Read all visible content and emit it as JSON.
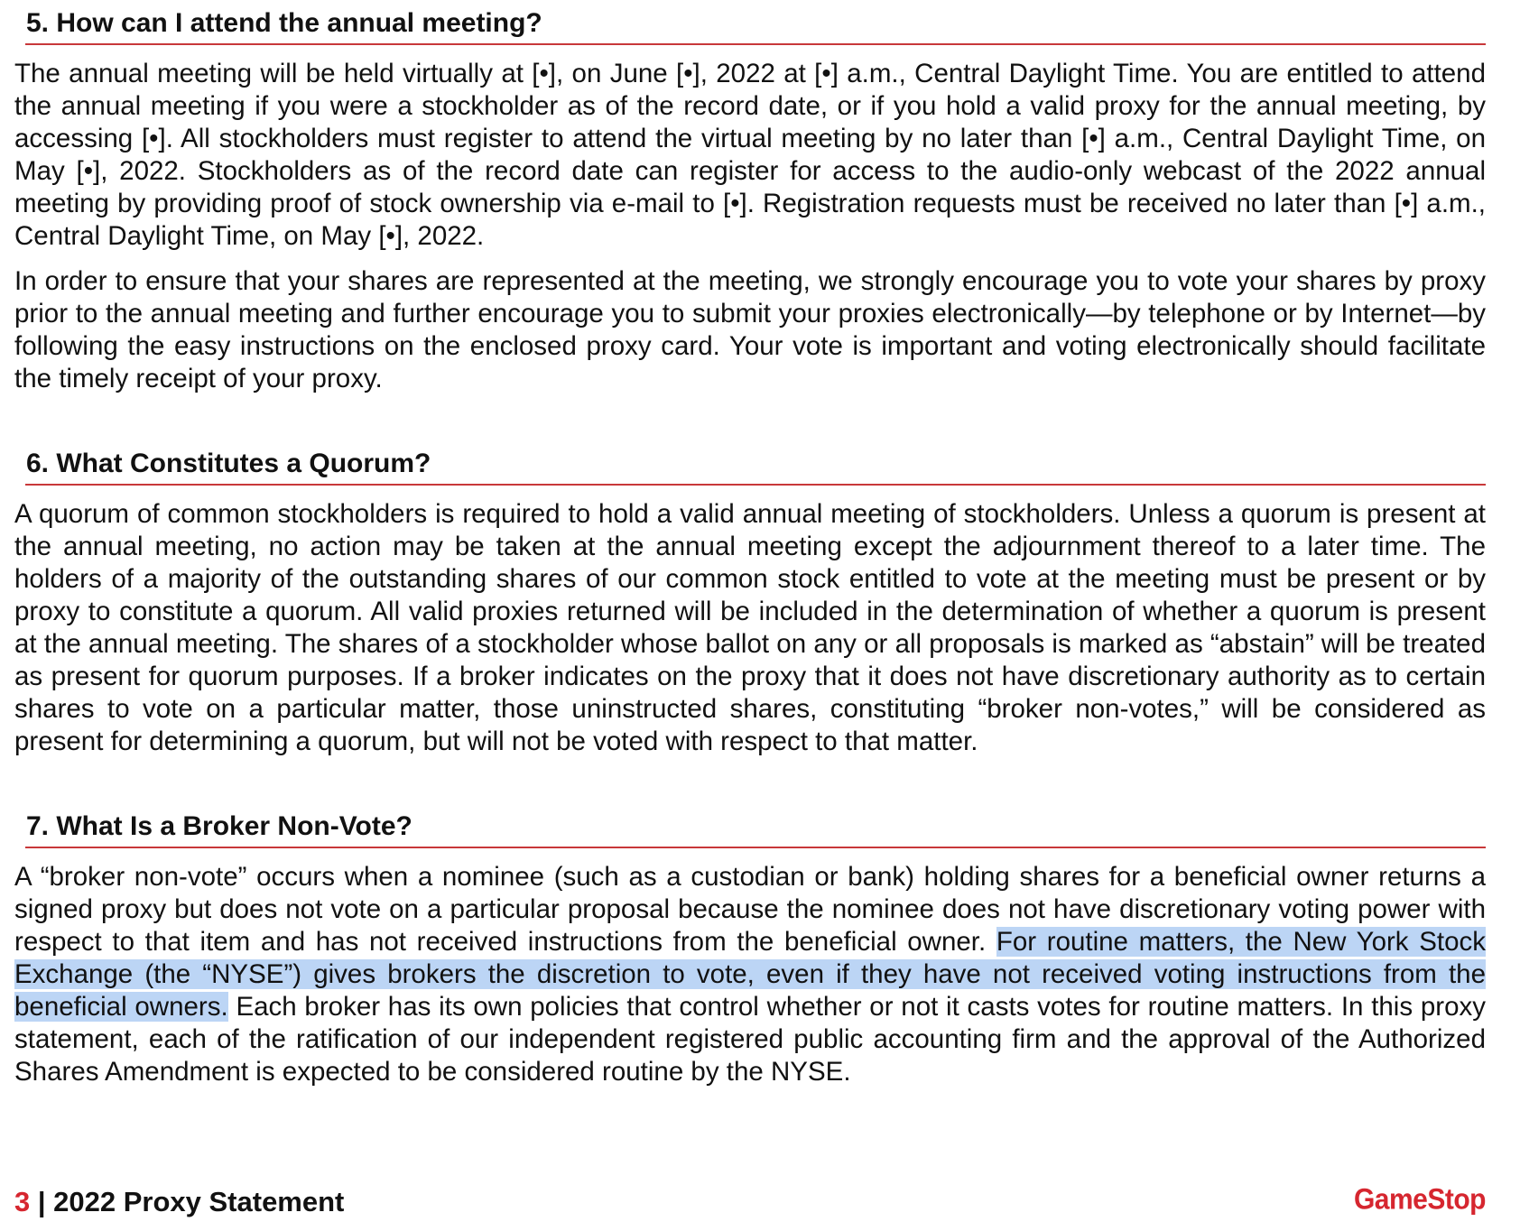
{
  "sections": [
    {
      "heading": "5. How can I attend the annual meeting?",
      "paragraphs": [
        "The annual meeting will be held virtually at [•], on June [•], 2022 at [•] a.m., Central Daylight Time. You are entitled to attend the annual meeting if you were a stockholder as of the record date, or if you hold a valid proxy for the annual meeting, by accessing [•]. All stockholders must register to attend the virtual meeting by no later than [•] a.m., Central Daylight Time, on May [•], 2022. Stockholders as of the record date can register for access to the audio-only webcast of the 2022 annual meeting by providing proof of stock ownership via e-mail to [•]. Registration requests must be received no later than [•] a.m., Central Daylight Time, on May [•], 2022.",
        "In order to ensure that your shares are represented at the meeting, we strongly encourage you to vote your shares by proxy prior to the annual meeting and further encourage you to submit your proxies electronically—by telephone or by Internet—by following the easy instructions on the enclosed proxy card. Your vote is important and voting electronically should facilitate the timely receipt of your proxy."
      ]
    },
    {
      "heading": "6. What Constitutes a Quorum?",
      "paragraphs": [
        "A quorum of common stockholders is required to hold a valid annual meeting of stockholders. Unless a quorum is present at the annual meeting, no action may be taken at the annual meeting except the adjournment thereof to a later time. The holders of a majority of the outstanding shares of our common stock entitled to vote at the meeting must be present or by proxy to constitute a quorum. All valid proxies returned will be included in the determination of whether a quorum is present at the annual meeting. The shares of a stockholder whose ballot on any or all proposals is marked as “abstain” will be treated as present for quorum purposes. If a broker indicates on the proxy that it does not have discretionary authority as to certain shares to vote on a particular matter, those uninstructed shares, constituting “broker non-votes,” will be considered as present for determining a quorum, but will not be voted with respect to that matter."
      ]
    },
    {
      "heading": "7. What Is a Broker Non-Vote?",
      "paragraph_before": "A “broker non-vote” occurs when a nominee (such as a custodian or bank) holding shares for a beneficial owner returns a signed proxy but does not vote on a particular proposal because the nominee does not have discretionary voting power with respect to that item and has not received instructions from the beneficial owner. ",
      "paragraph_highlighted": "For routine matters, the New York Stock Exchange (the “NYSE”) gives brokers the discretion to vote, even if they have not received voting instructions from the beneficial owners.",
      "paragraph_after": " Each broker has its own policies that control whether or not it casts votes for routine matters. In this proxy statement, each of the ratification of our independent registered public accounting firm and the approval of the Authorized Shares Amendment is expected to be considered routine by the NYSE."
    }
  ],
  "footer": {
    "page_number": "3",
    "separator": " | ",
    "document_title": "2022 Proxy Statement",
    "brand": "GameStop"
  },
  "colors": {
    "rule": "#c8383a",
    "brand_red": "#d6262f",
    "selection_highlight": "#bcd5f5",
    "text": "#111111"
  }
}
